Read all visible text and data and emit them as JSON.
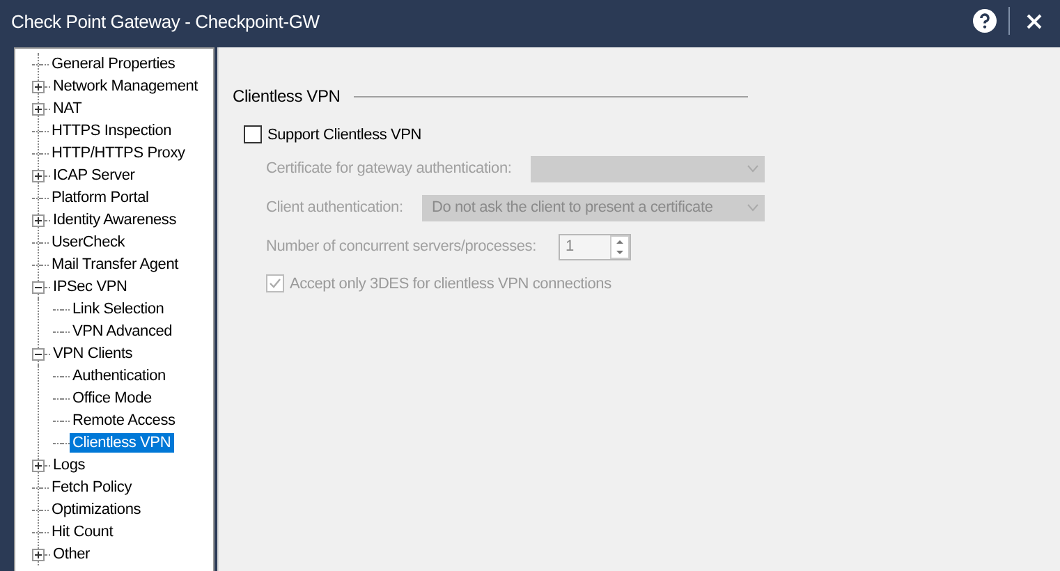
{
  "window": {
    "title": "Check Point Gateway - Checkpoint-GW"
  },
  "tree": [
    {
      "label": "General Properties",
      "selected": false
    },
    {
      "label": "Network Management",
      "selected": false,
      "expanded": false
    },
    {
      "label": "NAT",
      "selected": false,
      "expanded": false
    },
    {
      "label": "HTTPS Inspection",
      "selected": false
    },
    {
      "label": "HTTP/HTTPS Proxy",
      "selected": false
    },
    {
      "label": "ICAP Server",
      "selected": false,
      "expanded": false
    },
    {
      "label": "Platform Portal",
      "selected": false
    },
    {
      "label": "Identity Awareness",
      "selected": false,
      "expanded": false
    },
    {
      "label": "UserCheck",
      "selected": false
    },
    {
      "label": "Mail Transfer Agent",
      "selected": false
    },
    {
      "label": "IPSec VPN",
      "selected": false,
      "expanded": true,
      "children": [
        {
          "label": "Link Selection",
          "selected": false
        },
        {
          "label": "VPN Advanced",
          "selected": false
        }
      ]
    },
    {
      "label": "VPN Clients",
      "selected": false,
      "expanded": true,
      "children": [
        {
          "label": "Authentication",
          "selected": false
        },
        {
          "label": "Office Mode",
          "selected": false
        },
        {
          "label": "Remote Access",
          "selected": false
        },
        {
          "label": "Clientless VPN",
          "selected": true
        }
      ]
    },
    {
      "label": "Logs",
      "selected": false,
      "expanded": false
    },
    {
      "label": "Fetch Policy",
      "selected": false
    },
    {
      "label": "Optimizations",
      "selected": false
    },
    {
      "label": "Hit Count",
      "selected": false
    },
    {
      "label": "Other",
      "selected": false,
      "expanded": false
    }
  ],
  "section": {
    "title": "Clientless VPN",
    "support": {
      "label": "Support Clientless VPN",
      "checked": false
    },
    "fields": [
      {
        "kind": "dropdown",
        "label": "Certificate for gateway authentication:",
        "disabled": true
      },
      {
        "kind": "dropdown",
        "label": "Client authentication:",
        "value": "Do not ask the client to present a certificate",
        "disabled": true
      },
      {
        "kind": "spinner",
        "label": "Number of concurrent servers/processes:",
        "value": "1",
        "disabled": true
      },
      {
        "kind": "checkbox",
        "label": "Accept only 3DES for clientless VPN connections",
        "checked": true,
        "disabled": true
      }
    ]
  }
}
